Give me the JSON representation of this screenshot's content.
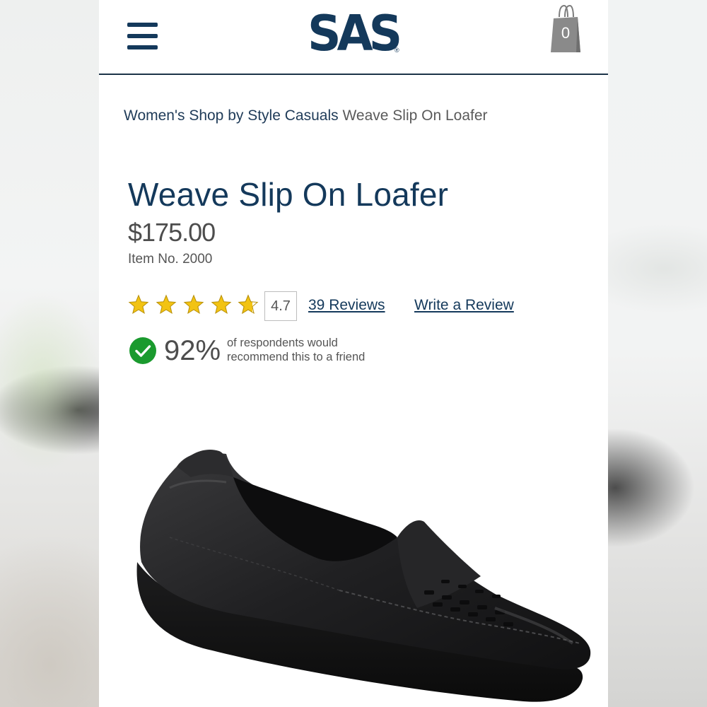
{
  "header": {
    "menu_icon": "hamburger-menu-icon",
    "logo_text": "SAS",
    "logo_registered": "®",
    "cart_icon": "shopping-bag-icon",
    "cart_count": "0"
  },
  "breadcrumb": {
    "items": [
      "Women's Shop by Style",
      "Casuals"
    ],
    "current": "Weave Slip On Loafer"
  },
  "product": {
    "title": "Weave Slip On Loafer",
    "price": "$175.00",
    "item_number": "Item No. 2000",
    "rating": {
      "value": "4.7",
      "stars_total": 5,
      "stars_filled_fraction": 0.94,
      "star_color": "#f2c313",
      "reviews_link": "39 Reviews",
      "write_review_link": "Write a Review"
    },
    "recommend": {
      "icon": "check-circle-icon",
      "icon_color": "#1a9a2e",
      "percent": "92%",
      "text_line1": "of respondents would",
      "text_line2": "recommend this to a friend"
    },
    "image_icon": "black-loafer-shoe-image"
  },
  "colors": {
    "brand_navy": "#14395b",
    "text_gray": "#4d4d4d"
  }
}
